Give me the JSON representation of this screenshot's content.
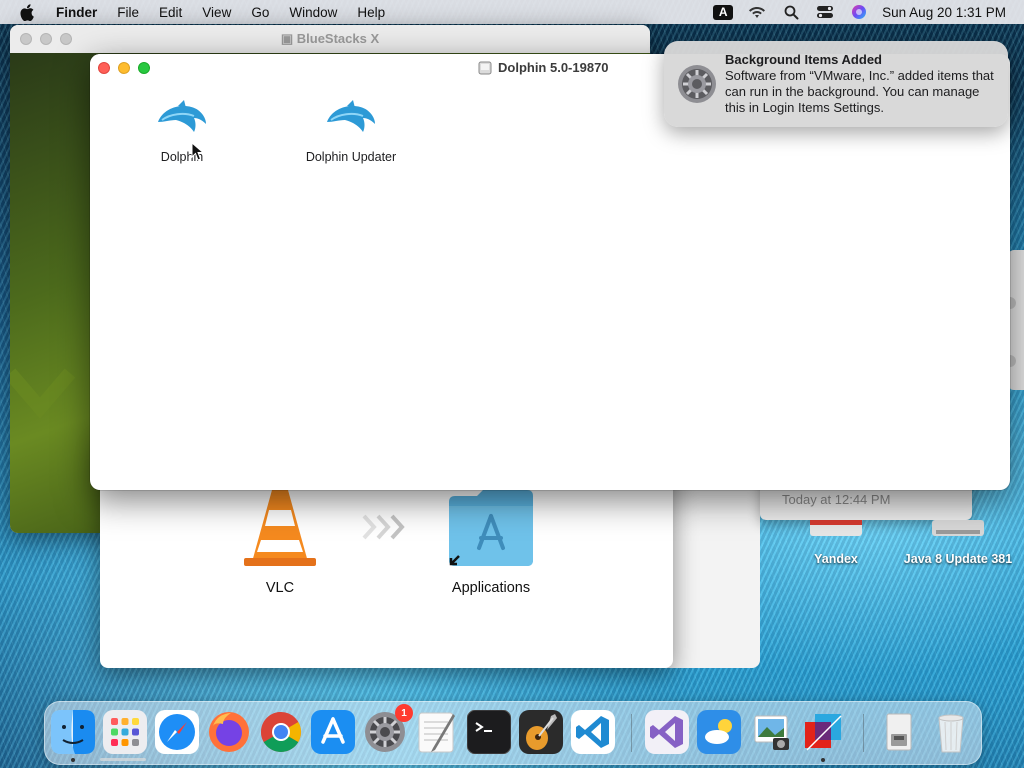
{
  "menubar": {
    "app_name": "Finder",
    "items": [
      "File",
      "Edit",
      "View",
      "Go",
      "Window",
      "Help"
    ],
    "input_source": "A",
    "clock": "Sun Aug 20  1:31 PM"
  },
  "bluestacks_window": {
    "title": "BlueStacks X"
  },
  "finder_window": {
    "title": "Dolphin 5.0-19870",
    "items": [
      {
        "label": "Dolphin",
        "icon": "dolphin-app-icon"
      },
      {
        "label": "Dolphin Updater",
        "icon": "dolphin-app-icon"
      }
    ]
  },
  "dmg_window": {
    "items": [
      {
        "label": "VLC",
        "icon": "vlc-cone-icon"
      },
      {
        "label": "Applications",
        "icon": "applications-folder-icon"
      }
    ]
  },
  "right_window": {
    "timestamp": "Today at 12:44 PM"
  },
  "desktop_items": [
    {
      "label": "Yandex"
    },
    {
      "label": "Java 8 Update 381"
    }
  ],
  "notification": {
    "title": "Background Items Added",
    "message": "Software from “VMware, Inc.” added items that can run in the background. You can manage this in Login Items Settings.",
    "icon": "system-settings-gear-icon"
  },
  "dock": {
    "apps": [
      "finder-icon",
      "launchpad-icon",
      "safari-icon",
      "firefox-icon",
      "chrome-icon",
      "app-store-icon",
      "system-settings-icon",
      "textedit-icon",
      "terminal-icon",
      "garageband-icon",
      "vscode-icon",
      "visual-studio-icon",
      "weather-icon",
      "preview-icon",
      "vmware-fusion-icon",
      "disk-image-icon",
      "trash-icon"
    ],
    "system_settings_badge": "1"
  },
  "colors": {
    "close": "#ff5f57",
    "minimize": "#febc2e",
    "zoom": "#28c840",
    "dolphin_blue": "#35a9e0",
    "badge_red": "#ff3b30"
  }
}
